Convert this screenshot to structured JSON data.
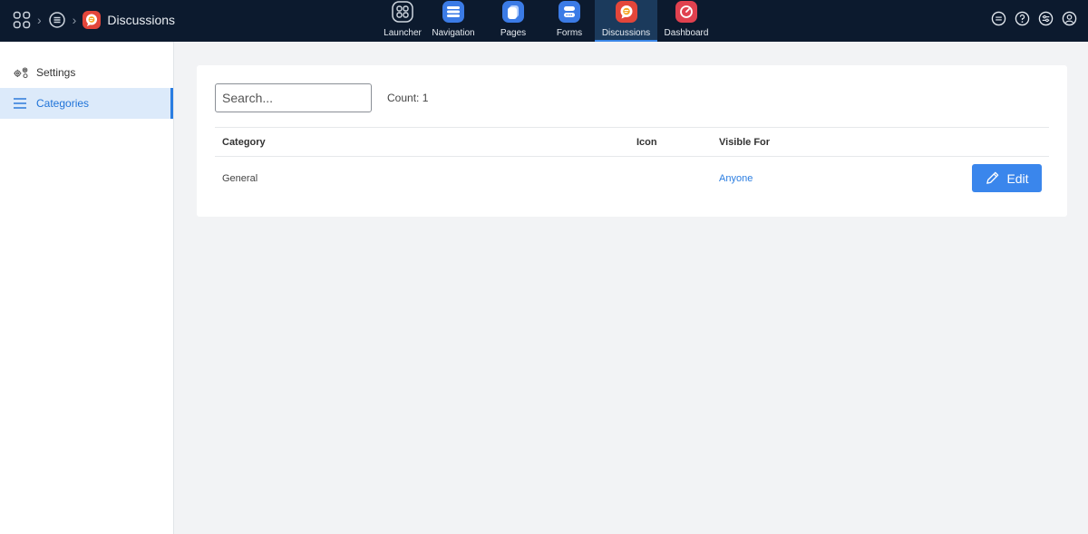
{
  "breadcrumb": {
    "home_icon": "grid-icon",
    "section_icon": "list-circle-icon",
    "app_icon": "discussions-icon",
    "title": "Discussions"
  },
  "apps": [
    {
      "label": "Launcher",
      "icon": "launcher-icon",
      "color": "#0c1a2e",
      "active": false
    },
    {
      "label": "Navigation",
      "icon": "navigation-icon",
      "color": "#3b7be6",
      "active": false
    },
    {
      "label": "Pages",
      "icon": "pages-icon",
      "color": "#3b7be6",
      "active": false
    },
    {
      "label": "Forms",
      "icon": "forms-icon",
      "color": "#3b7be6",
      "active": false
    },
    {
      "label": "Discussions",
      "icon": "discussions-icon",
      "color": "#e3463a",
      "active": true
    },
    {
      "label": "Dashboard",
      "icon": "dashboard-icon",
      "color": "#e0414f",
      "active": false
    }
  ],
  "header_icons": [
    "chat-icon",
    "help-icon",
    "tune-icon",
    "user-icon"
  ],
  "sidebar": {
    "items": [
      {
        "label": "Settings",
        "icon": "gears-icon",
        "active": false
      },
      {
        "label": "Categories",
        "icon": "menu-lines-icon",
        "active": true
      }
    ]
  },
  "main": {
    "search_placeholder": "Search...",
    "count_text": "Count: 1",
    "table": {
      "columns": [
        "Category",
        "Icon",
        "Visible For"
      ],
      "rows": [
        {
          "category": "General",
          "icon": "",
          "visible_for": "Anyone",
          "action": "Edit"
        }
      ]
    }
  },
  "colors": {
    "topbar": "#0c1a2e",
    "accent": "#3a86ec",
    "active_sidebar_bg": "#dceafa"
  }
}
